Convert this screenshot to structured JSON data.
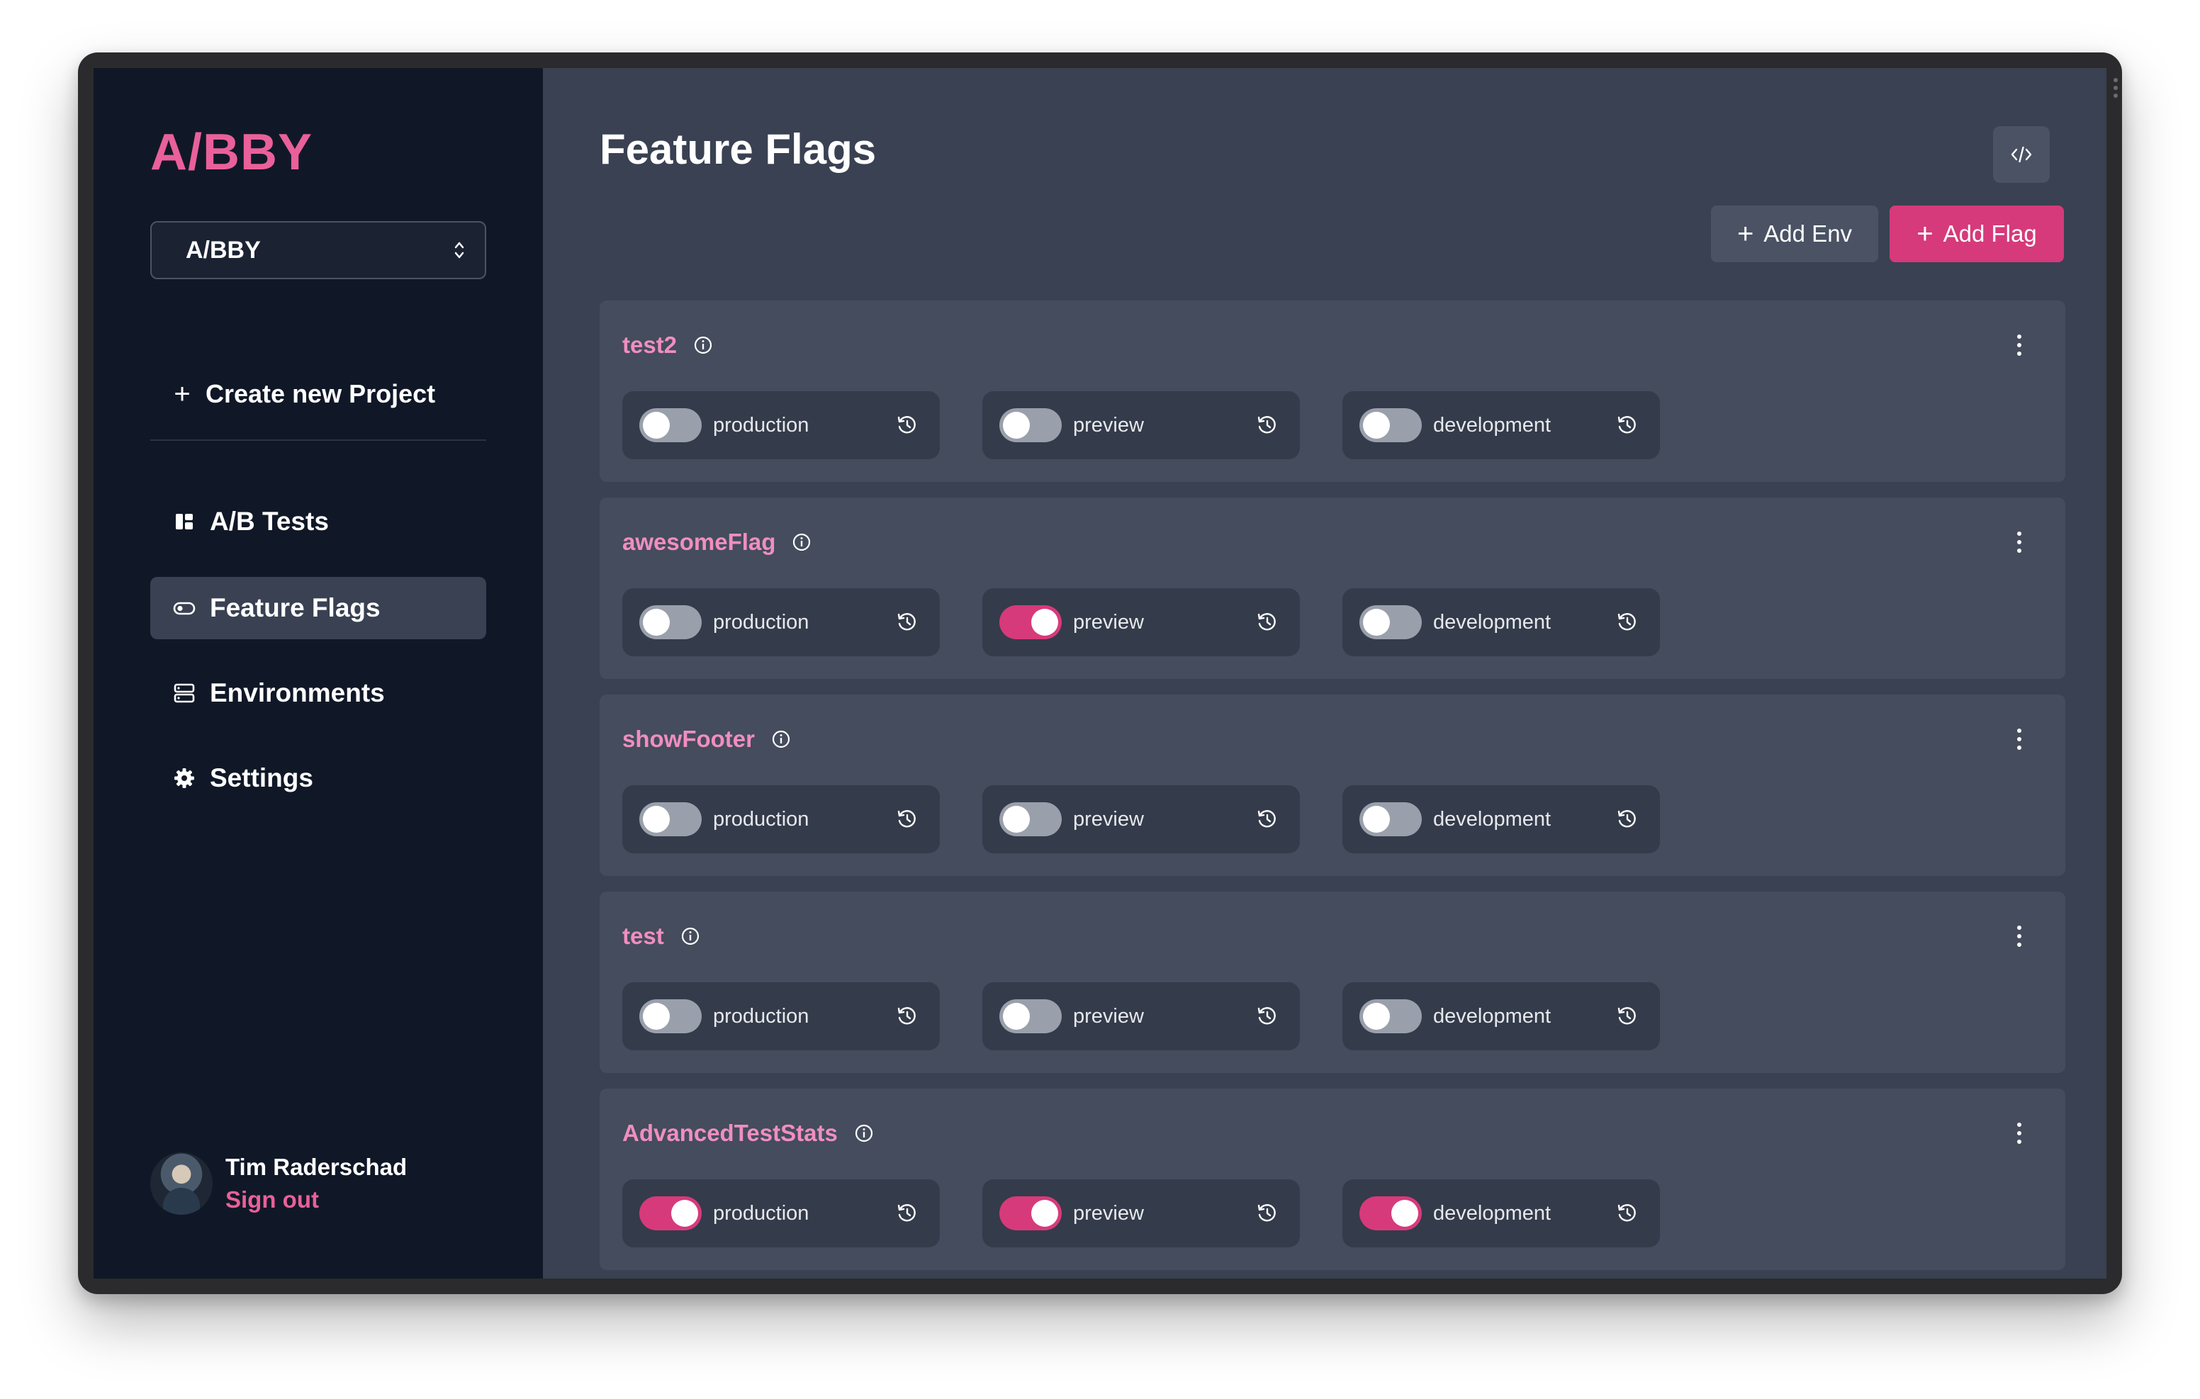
{
  "sidebar": {
    "brand": "A/BBY",
    "project_select": {
      "value": "A/BBY"
    },
    "create_project_label": "Create new Project",
    "nav": [
      {
        "label": "A/B Tests",
        "icon": "dashboard-icon",
        "active": false
      },
      {
        "label": "Feature Flags",
        "icon": "toggle-icon",
        "active": true
      },
      {
        "label": "Environments",
        "icon": "server-icon",
        "active": false
      },
      {
        "label": "Settings",
        "icon": "gear-icon",
        "active": false
      }
    ],
    "user": {
      "name": "Tim Raderschad",
      "sign_out": "Sign out"
    }
  },
  "main": {
    "title": "Feature Flags",
    "add_env_label": "Add Env",
    "add_flag_label": "Add Flag",
    "flags": [
      {
        "name": "test2",
        "envs": [
          {
            "name": "production",
            "enabled": false
          },
          {
            "name": "preview",
            "enabled": false
          },
          {
            "name": "development",
            "enabled": false
          }
        ]
      },
      {
        "name": "awesomeFlag",
        "envs": [
          {
            "name": "production",
            "enabled": false
          },
          {
            "name": "preview",
            "enabled": true
          },
          {
            "name": "development",
            "enabled": false
          }
        ]
      },
      {
        "name": "showFooter",
        "envs": [
          {
            "name": "production",
            "enabled": false
          },
          {
            "name": "preview",
            "enabled": false
          },
          {
            "name": "development",
            "enabled": false
          }
        ]
      },
      {
        "name": "test",
        "envs": [
          {
            "name": "production",
            "enabled": false
          },
          {
            "name": "preview",
            "enabled": false
          },
          {
            "name": "development",
            "enabled": false
          }
        ]
      },
      {
        "name": "AdvancedTestStats",
        "envs": [
          {
            "name": "production",
            "enabled": true
          },
          {
            "name": "preview",
            "enabled": true
          },
          {
            "name": "development",
            "enabled": true
          }
        ]
      }
    ]
  },
  "colors": {
    "accent": "#d63a7a",
    "brand": "#e9609a",
    "flag_name": "#f08ec0",
    "sidebar_bg": "#101827",
    "main_bg": "#394152"
  }
}
